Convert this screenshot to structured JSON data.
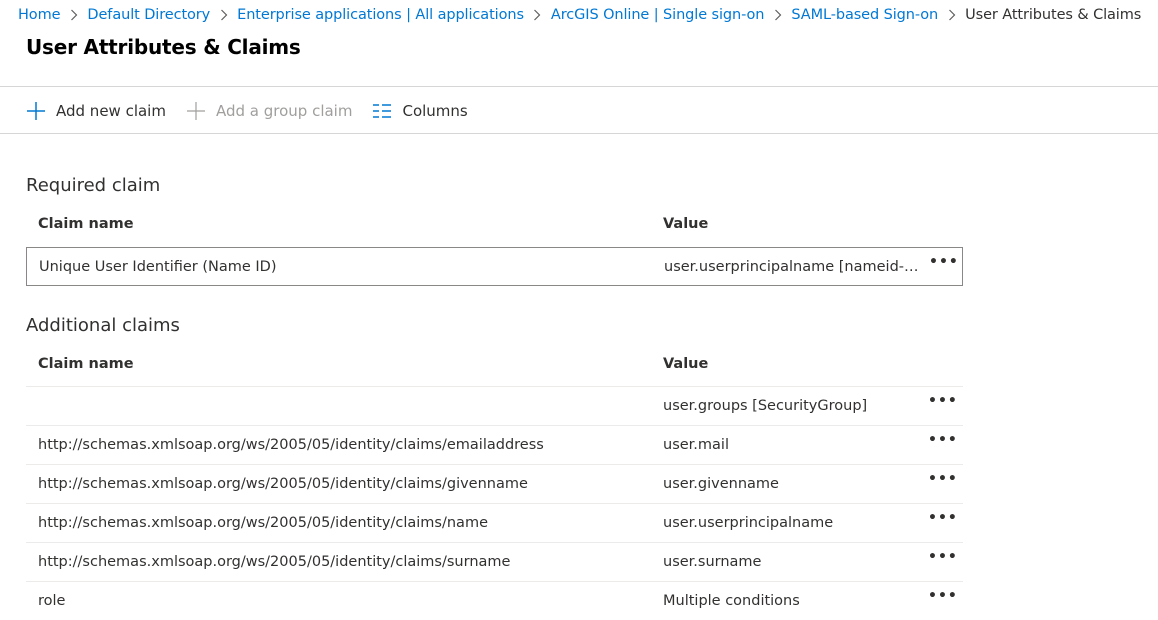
{
  "breadcrumb": {
    "items": [
      {
        "label": "Home"
      },
      {
        "label": "Default Directory"
      },
      {
        "label": "Enterprise applications | All applications"
      },
      {
        "label": "ArcGIS Online | Single sign-on"
      },
      {
        "label": "SAML-based Sign-on"
      }
    ],
    "current": "User Attributes & Claims"
  },
  "page": {
    "title": "User Attributes & Claims"
  },
  "toolbar": {
    "add_claim": "Add new claim",
    "add_group_claim": "Add a group claim",
    "columns": "Columns"
  },
  "required": {
    "title": "Required claim",
    "header": {
      "name": "Claim name",
      "value": "Value"
    },
    "rows": [
      {
        "name": "Unique User Identifier (Name ID)",
        "value": "user.userprincipalname [nameid-f...",
        "more": "•••"
      }
    ]
  },
  "additional": {
    "title": "Additional claims",
    "header": {
      "name": "Claim name",
      "value": "Value"
    },
    "rows": [
      {
        "name": "",
        "value": "user.groups [SecurityGroup]",
        "more": "•••"
      },
      {
        "name": "http://schemas.xmlsoap.org/ws/2005/05/identity/claims/emailaddress",
        "value": "user.mail",
        "more": "•••"
      },
      {
        "name": "http://schemas.xmlsoap.org/ws/2005/05/identity/claims/givenname",
        "value": "user.givenname",
        "more": "•••"
      },
      {
        "name": "http://schemas.xmlsoap.org/ws/2005/05/identity/claims/name",
        "value": "user.userprincipalname",
        "more": "•••"
      },
      {
        "name": "http://schemas.xmlsoap.org/ws/2005/05/identity/claims/surname",
        "value": "user.surname",
        "more": "•••"
      },
      {
        "name": "role",
        "value": "Multiple conditions",
        "more": "•••"
      }
    ]
  },
  "colors": {
    "link": "#0078d4",
    "disabled": "#a19f9d",
    "text": "#323130"
  }
}
